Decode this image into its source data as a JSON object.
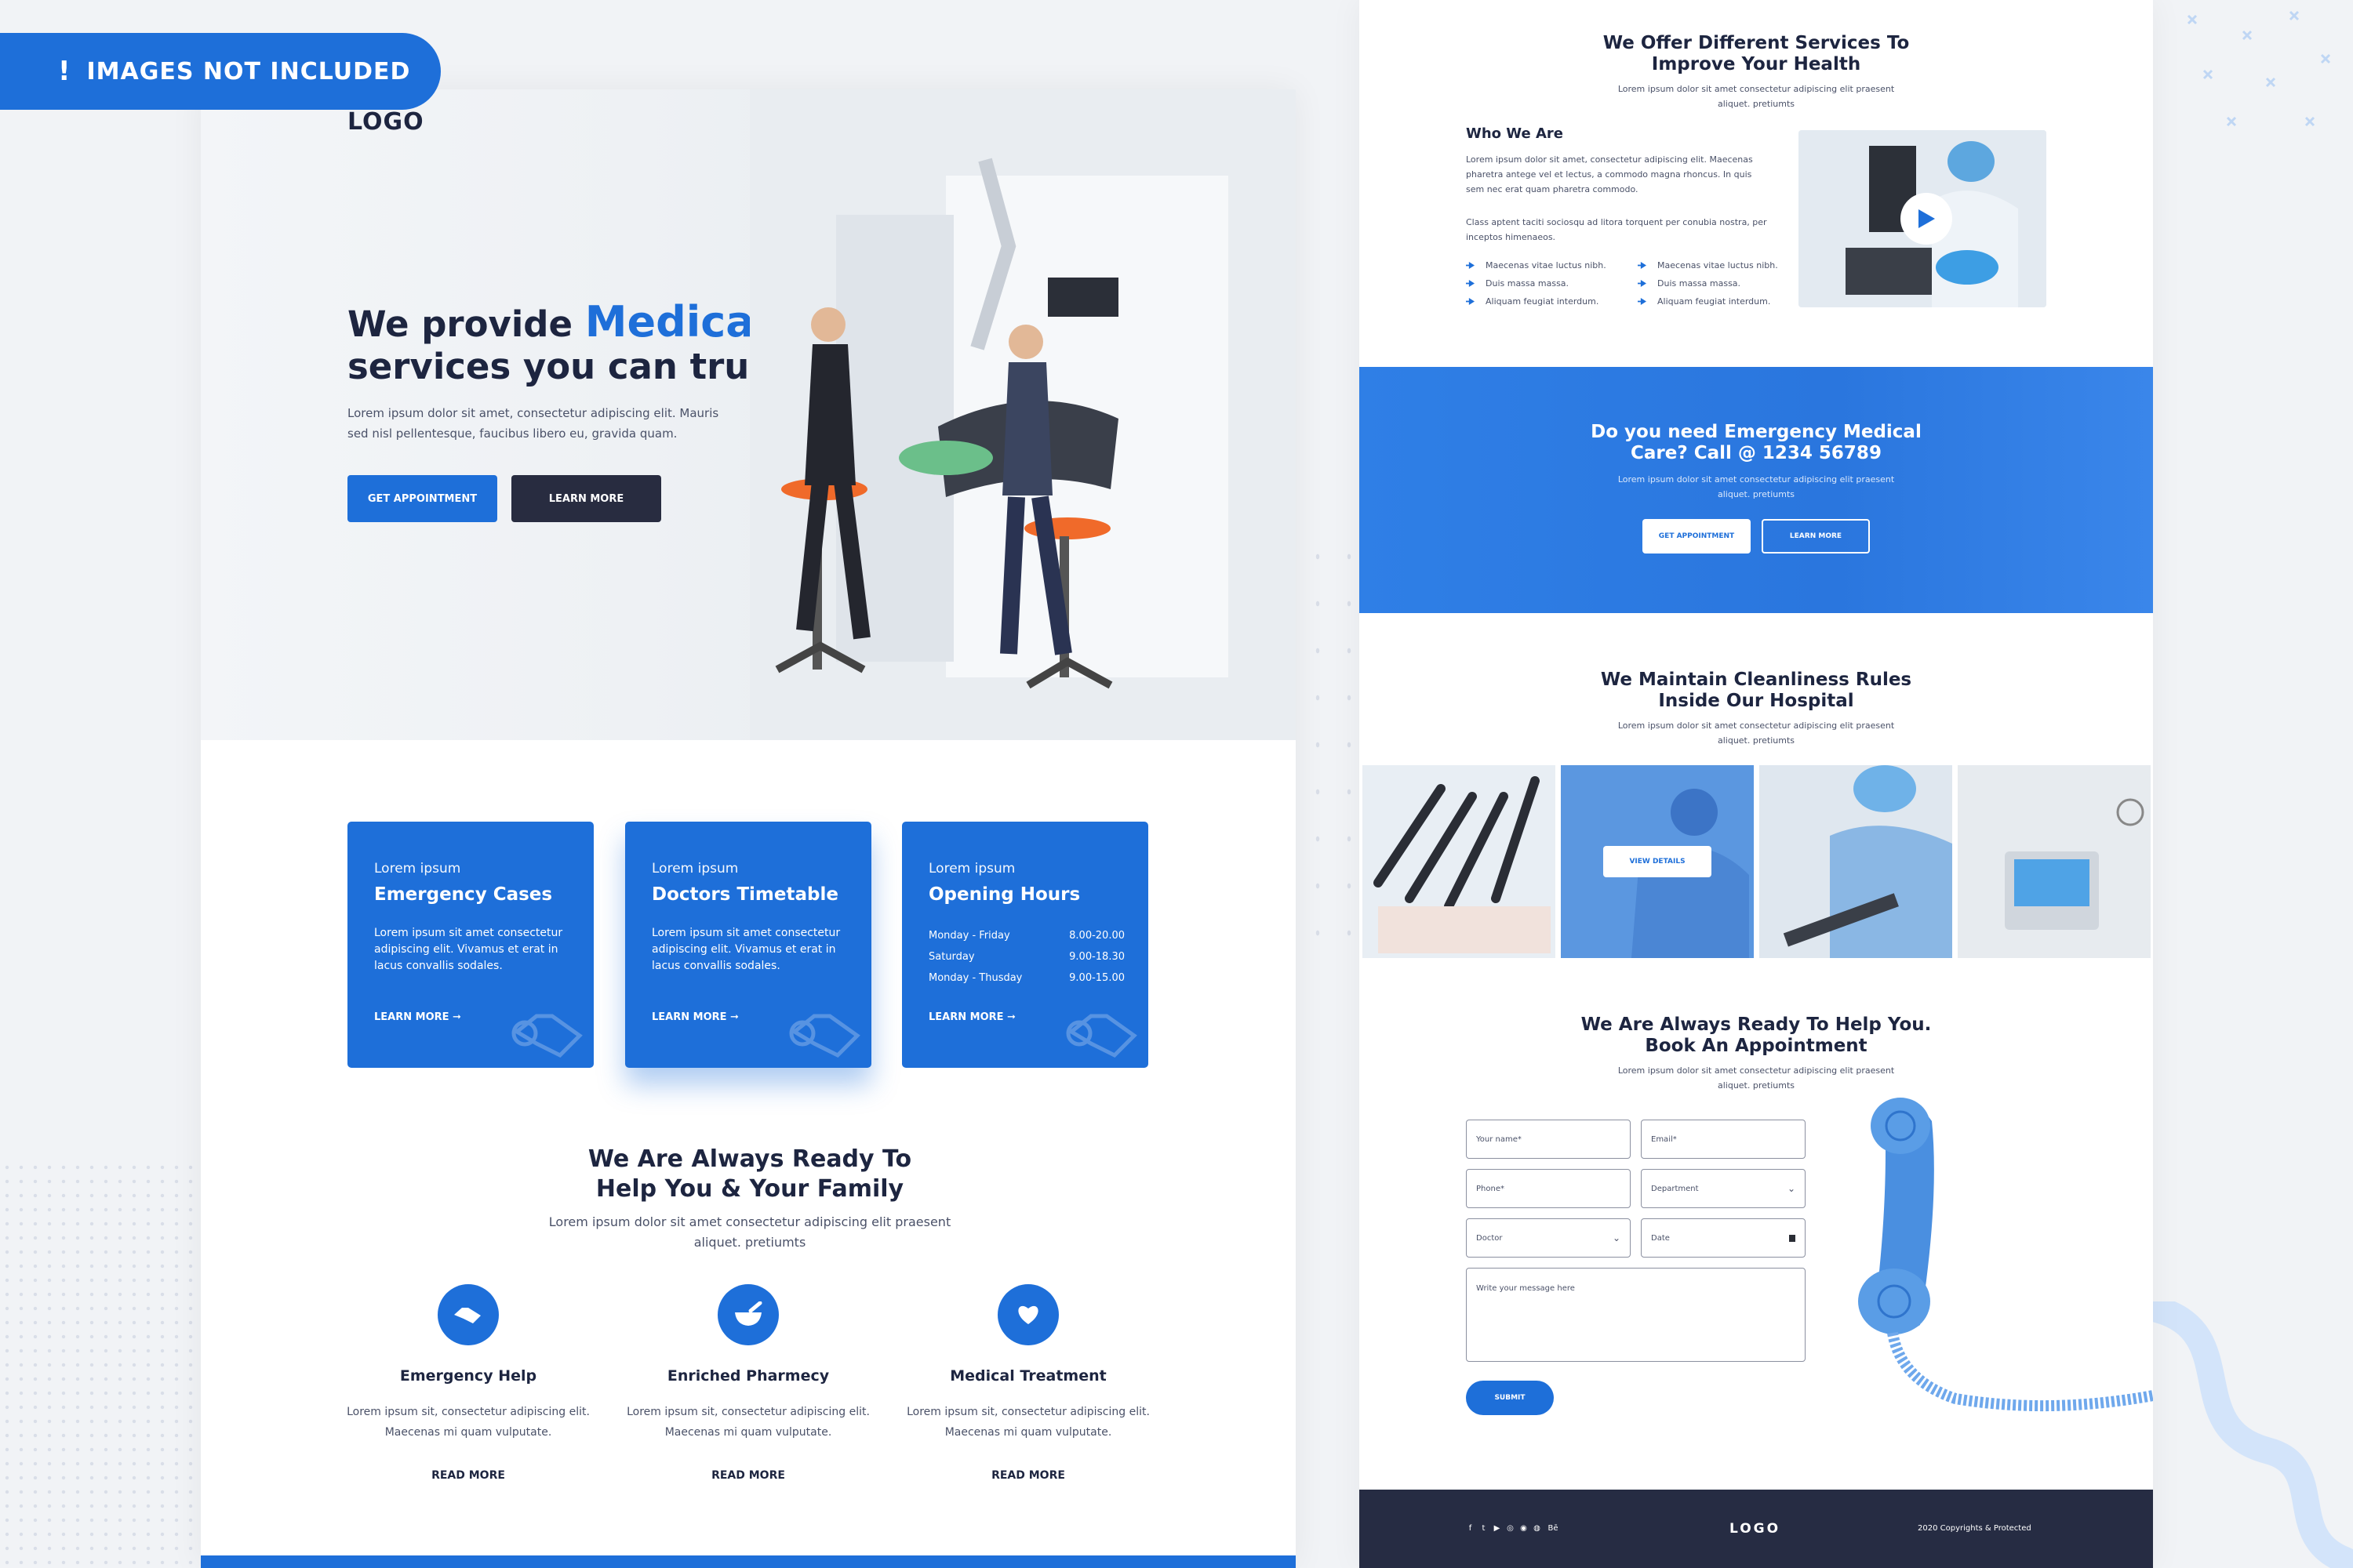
{
  "badge": {
    "icon": "!",
    "text": "IMAGES NOT INCLUDED"
  },
  "left": {
    "logo": "LOGO",
    "hero": {
      "title_a": "We provide ",
      "title_highlight": "Medical",
      "title_b": "services you can trust!",
      "desc": "Lorem ipsum dolor sit amet, consectetur adipiscing elit. Mauris sed nisl pellentesque, faucibus libero eu, gravida quam.",
      "btn_primary": "GET APPOINTMENT",
      "btn_secondary": "LEARN MORE"
    },
    "cards": [
      {
        "sub": "Lorem ipsum",
        "title": "Emergency Cases",
        "desc": "Lorem ipsum sit amet consectetur adipiscing elit. Vivamus et erat in lacus convallis sodales.",
        "more": "LEARN MORE ➞"
      },
      {
        "sub": "Lorem ipsum",
        "title": "Doctors Timetable",
        "desc": "Lorem ipsum sit amet consectetur adipiscing elit. Vivamus et erat in lacus convallis sodales.",
        "more": "LEARN MORE ➞"
      },
      {
        "sub": "Lorem ipsum",
        "title": "Opening Hours",
        "hours": [
          {
            "day": "Monday - Friday",
            "time": "8.00-20.00"
          },
          {
            "day": "Saturday",
            "time": "9.00-18.30"
          },
          {
            "day": "Monday - Thusday",
            "time": "9.00-15.00"
          }
        ],
        "more": "LEARN MORE ➞"
      }
    ],
    "ready": {
      "title_1": "We Are Always Ready To",
      "title_2": "Help You & Your Family",
      "sub_1": "Lorem ipsum dolor sit amet consectetur adipiscing elit praesent",
      "sub_2": "aliquet. pretiumts"
    },
    "features": [
      {
        "icon": "handshake-icon",
        "title": "Emergency Help",
        "d1": "Lorem ipsum sit, consectetur adipiscing elit.",
        "d2": "Maecenas mi quam vulputate.",
        "more": "READ MORE"
      },
      {
        "icon": "mortar-pestle-icon",
        "title": "Enriched Pharmecy",
        "d1": "Lorem ipsum sit, consectetur adipiscing elit.",
        "d2": "Maecenas mi quam vulputate.",
        "more": "READ MORE"
      },
      {
        "icon": "heart-icon",
        "title": "Medical Treatment",
        "d1": "Lorem ipsum sit, consectetur adipiscing elit.",
        "d2": "Maecenas mi quam vulputate.",
        "more": "READ MORE"
      }
    ]
  },
  "right": {
    "services": {
      "t1": "We Offer Different Services To",
      "t2": "Improve Your Health",
      "s1": "Lorem ipsum dolor sit amet consectetur adipiscing elit praesent",
      "s2": "aliquet. pretiumts"
    },
    "who": {
      "title": "Who We Are",
      "p1": "Lorem ipsum dolor sit amet, consectetur adipiscing elit. Maecenas pharetra antege vel et lectus, a commodo magna rhoncus. In quis sem nec erat quam pharetra commodo.",
      "p2": "Class aptent taciti sociosqu ad litora torquent per conubia nostra, per inceptos himenaeos.",
      "list_a": [
        "Maecenas vitae luctus nibh.",
        "Duis massa massa.",
        "Aliquam feugiat interdum."
      ],
      "list_b": [
        "Maecenas vitae luctus nibh.",
        "Duis massa massa.",
        "Aliquam feugiat interdum."
      ]
    },
    "emergency": {
      "t1": "Do you need Emergency Medical",
      "t2": "Care? Call @ 1234 56789",
      "s1": "Lorem ipsum dolor sit amet consectetur adipiscing elit praesent",
      "s2": "aliquet. pretiumts",
      "btn_primary": "GET APPOINTMENT",
      "btn_secondary": "LEARN MORE"
    },
    "clean": {
      "t1": "We Maintain Cleanliness Rules",
      "t2": "Inside Our Hospital",
      "s1": "Lorem ipsum dolor sit amet consectetur adipiscing elit praesent",
      "s2": "aliquet. pretiumts",
      "view": "VIEW DETAILS"
    },
    "appointment": {
      "t1": "We Are Always Ready To Help You.",
      "t2": "Book An Appointment",
      "s1": "Lorem ipsum dolor sit amet consectetur adipiscing elit praesent",
      "s2": "aliquet. pretiumts",
      "name": "Your name*",
      "email": "Email*",
      "phone": "Phone*",
      "department": "Department",
      "doctor": "Doctor",
      "date": "Date",
      "message": "Write your message here",
      "submit": "SUBMIT"
    },
    "footer": {
      "logo": "LOGO",
      "copyright": "2020 Copyrights & Protected",
      "social": [
        "f",
        "t",
        "▶",
        "◎",
        "◉",
        "◍",
        "Bē"
      ]
    }
  },
  "colors": {
    "primary": "#1e6fd9",
    "dark": "#262c43"
  }
}
